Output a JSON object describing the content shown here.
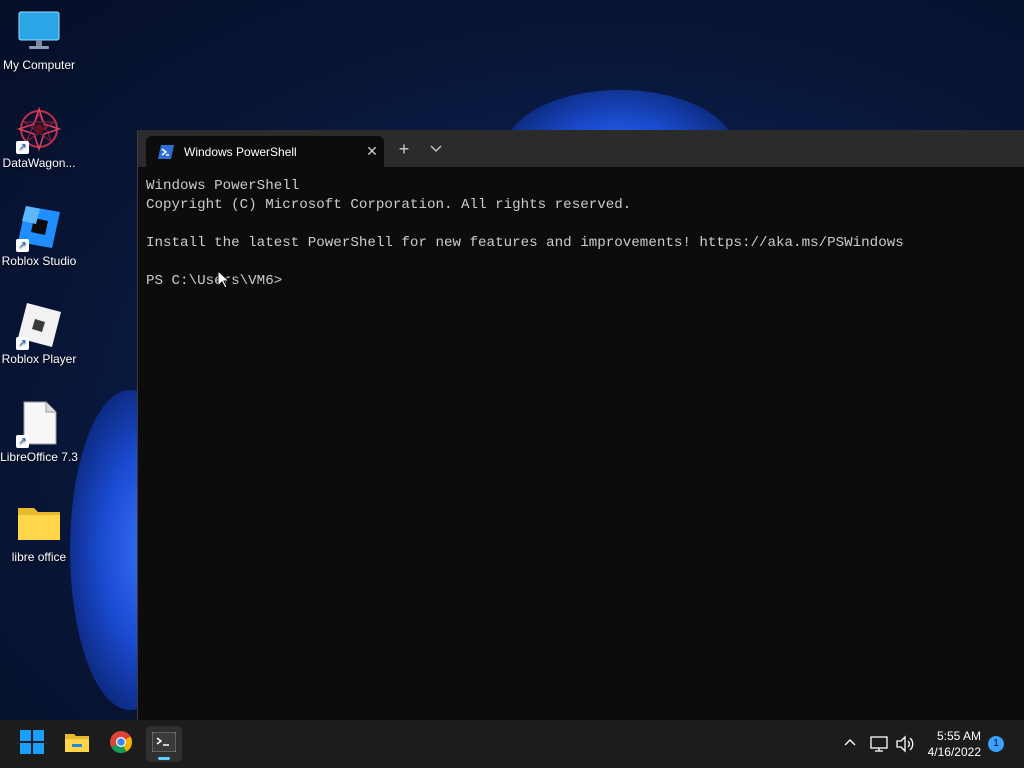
{
  "desktop": {
    "icons": [
      {
        "label": "My Computer",
        "icon": "monitor-icon"
      },
      {
        "label": "DataWagon...",
        "icon": "datawagon-icon"
      },
      {
        "label": "Roblox Studio",
        "icon": "roblox-studio-icon"
      },
      {
        "label": "Roblox Player",
        "icon": "roblox-player-icon"
      },
      {
        "label": "LibreOffice 7.3",
        "icon": "libreoffice-icon"
      },
      {
        "label": "libre office",
        "icon": "folder-icon"
      }
    ]
  },
  "terminal": {
    "tab_title": "Windows PowerShell",
    "new_tab": "+",
    "lines": [
      "Windows PowerShell",
      "Copyright (C) Microsoft Corporation. All rights reserved.",
      "",
      "Install the latest PowerShell for new features and improvements! https://aka.ms/PSWindows",
      "",
      "PS C:\\Users\\VM6>"
    ]
  },
  "taskbar": {
    "apps": [
      "start-icon",
      "file-explorer-icon",
      "chrome-icon",
      "terminal-icon"
    ],
    "time": "5:55 AM",
    "date": "4/16/2022",
    "notification_count": "1"
  },
  "colors": {
    "accent": "#60cdff",
    "terminal_bg": "#0c0c0c",
    "taskbar_bg": "#1c1c1c"
  }
}
